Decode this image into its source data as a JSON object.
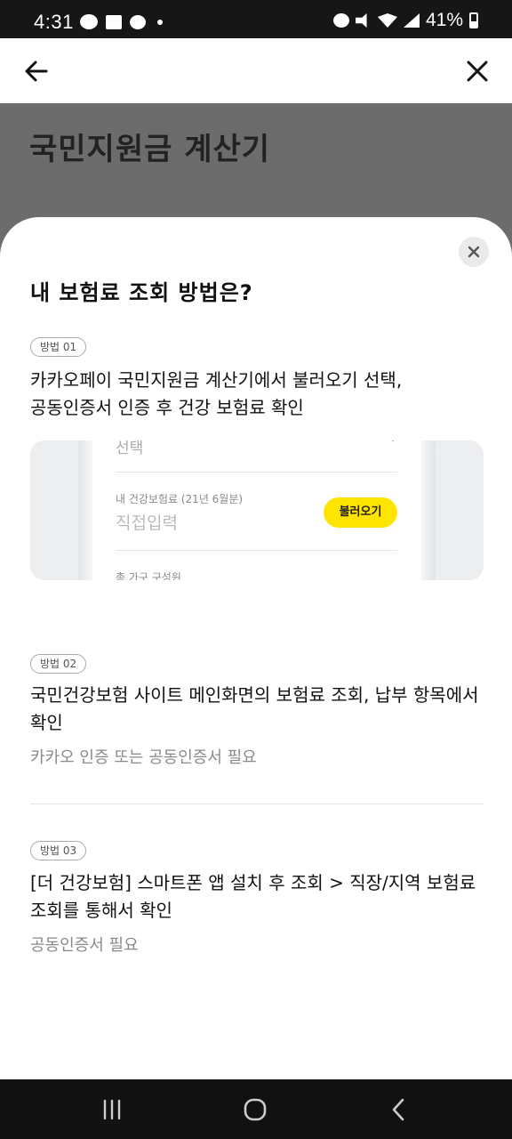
{
  "status_bar": {
    "time": "4:31",
    "battery": "41%",
    "notification_icons": [
      "kakaotalk-icon",
      "image-icon",
      "c-icon",
      "dot-icon"
    ],
    "system_icons": [
      "alarm-icon",
      "mute-icon",
      "wifi-icon",
      "hd-voice-icon",
      "signal-icon",
      "battery-icon"
    ],
    "battery_level": 0.41
  },
  "page": {
    "title": "국민지원금 계산기"
  },
  "sheet": {
    "title": "내 보험료 조회 방법은?",
    "methods": [
      {
        "badge": "방법 01",
        "text_line1": "카카오페이 국민지원금 계산기에서 불러오기 선택,",
        "text_line2": "공동인증서 인증 후 건강 보험료 확인"
      },
      {
        "badge": "방법 02",
        "text_line1": "국민건강보험 사이트 메인화면의 보험료 조회, 납부 항목에서",
        "text_line2": "확인",
        "sub": "카카오 인증 또는 공동인증서 필요"
      },
      {
        "badge": "방법 03",
        "text_line1": "[더 건강보험] 스마트폰 앱 설치 후 조회 > 직장/지역 보험료",
        "text_line2": "조회를 통해서 확인",
        "sub": "공동인증서 필요"
      }
    ],
    "illustration": {
      "top_fragment": "선택",
      "field_label": "내 건강보험료 (21년 6월분)",
      "field_placeholder": "직접입력",
      "button": "불러오기",
      "bottom_fragment": "총 가구 구성원"
    }
  },
  "colors": {
    "accent_yellow": "#fee500",
    "dim_overlay": "#6c6c6c",
    "status_bar": "#161616",
    "nav_bar": "#111111"
  }
}
